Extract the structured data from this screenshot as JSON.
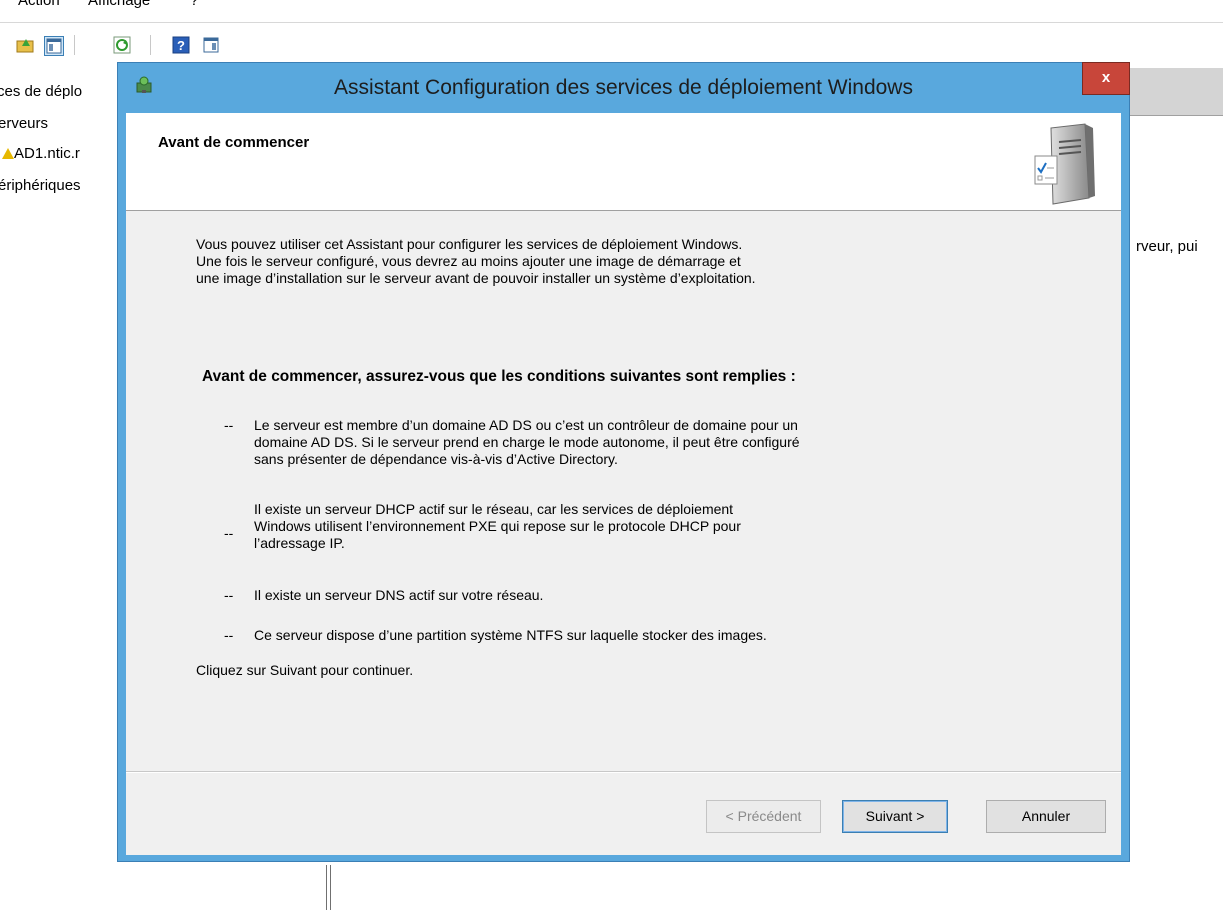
{
  "console": {
    "menu": [
      "Action",
      "Affichage",
      "?"
    ],
    "tree": [
      "ces de déplo",
      "erveurs",
      "AD1.ntic.r",
      "ériphériques"
    ],
    "right_text": "rveur, pui"
  },
  "dialog": {
    "title": "Assistant Configuration des services de déploiement Windows",
    "close_label": "x",
    "heading": "Avant de commencer",
    "intro": [
      "Vous pouvez utiliser cet Assistant pour configurer les services de déploiement Windows.",
      "Une fois le serveur configuré, vous devrez au moins ajouter une image de démarrage et",
      "une image d’installation sur le serveur avant de pouvoir installer un système d’exploitation."
    ],
    "conditions_heading": "Avant de commencer, assurez-vous que les conditions suivantes sont remplies :",
    "bullet_mark": "--",
    "conditions": [
      [
        "Le serveur est membre d’un domaine AD DS ou c’est un contrôleur de domaine pour un",
        "domaine AD DS. Si le serveur prend en charge le mode autonome, il peut être configuré",
        "sans présenter de dépendance vis-à-vis d’Active Directory."
      ],
      [
        "Il existe un serveur DHCP actif sur le réseau, car les services de déploiement",
        "Windows utilisent l’environnement PXE qui repose sur le protocole DHCP pour",
        "l’adressage IP."
      ],
      [
        "Il existe un serveur DNS actif sur votre réseau."
      ],
      [
        "Ce serveur dispose d’une partition système NTFS sur laquelle stocker des images."
      ]
    ],
    "continue_text": "Cliquez sur Suivant pour continuer.",
    "buttons": {
      "previous": "< Précédent",
      "next": "Suivant >",
      "cancel": "Annuler"
    }
  },
  "colors": {
    "frame": "#59a8dd",
    "close": "#c8463a",
    "client_bg": "#f0f0f0"
  }
}
